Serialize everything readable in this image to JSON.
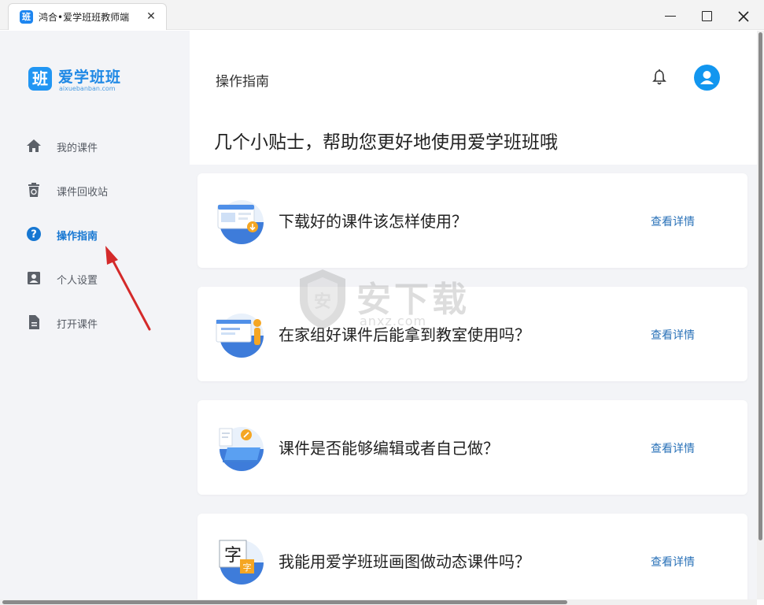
{
  "window": {
    "tab_title": "鸿合•爱学班班教师端",
    "tab_icon_char": "班",
    "close_tab_label": "✕"
  },
  "brand": {
    "mark_char": "班",
    "name": "爱学班班",
    "site": "aixuebanban.com",
    "color": "#1e88e5"
  },
  "sidebar": {
    "items": [
      {
        "label": "我的课件",
        "icon": "home-icon"
      },
      {
        "label": "课件回收站",
        "icon": "recycle-bin-icon"
      },
      {
        "label": "操作指南",
        "icon": "help-circle-icon",
        "active": true
      },
      {
        "label": "个人设置",
        "icon": "user-card-icon"
      },
      {
        "label": "打开课件",
        "icon": "document-icon"
      }
    ]
  },
  "header": {
    "title": "操作指南"
  },
  "main": {
    "heading": "几个小贴士，帮助您更好地使用爱学班班哦",
    "cards": [
      {
        "question": "下载好的课件该怎样使用？",
        "link": "查看详情",
        "illustration": "download-window-illustration"
      },
      {
        "question": "在家组好课件后能拿到教室使用吗？",
        "link": "查看详情",
        "illustration": "presentation-board-illustration"
      },
      {
        "question": "课件是否能够编辑或者自己做？",
        "link": "查看详情",
        "illustration": "edit-laptop-illustration"
      },
      {
        "question": "我能用爱学班班画图做动态课件吗？",
        "link": "查看详情",
        "illustration": "character-card-illustration"
      }
    ],
    "illustration_char": "字",
    "illustration_char_small": "字"
  },
  "watermark": {
    "text": "安下载",
    "sub": "anxz.com",
    "badge_char": "安"
  },
  "colors": {
    "accent": "#1677d2",
    "link": "#2a72b8",
    "sidebar_bg": "#f3f4f7"
  }
}
